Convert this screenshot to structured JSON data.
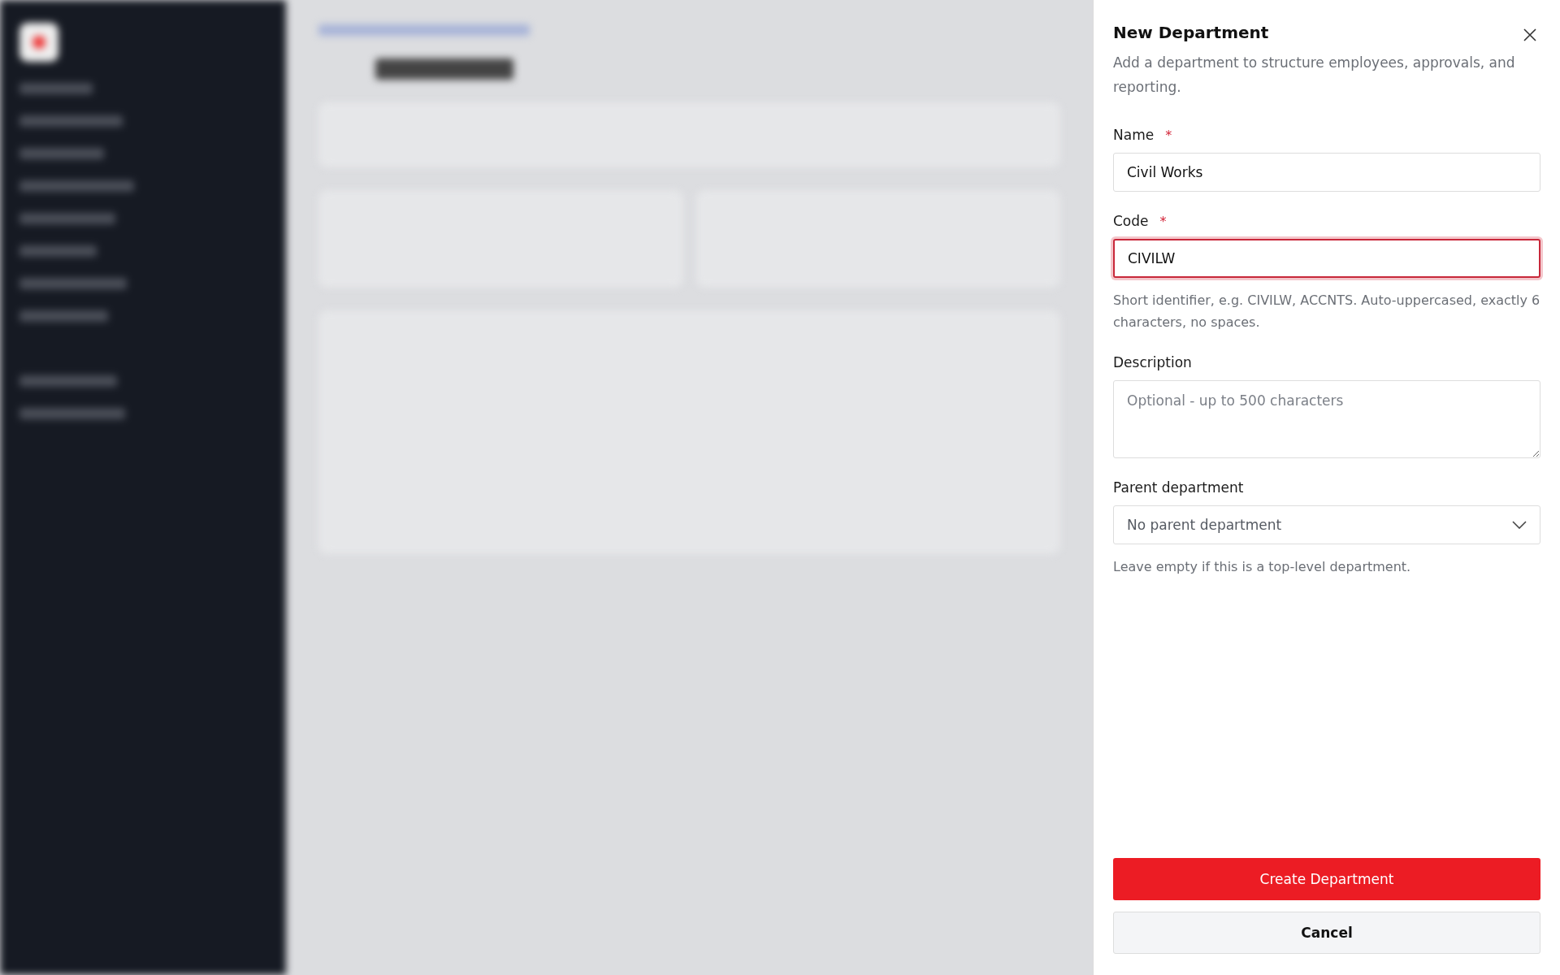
{
  "panel": {
    "title": "New Department",
    "subtitle": "Add a department to structure employees, approvals, and reporting.",
    "fields": [
      {
        "kind": "text",
        "label": "Name",
        "required_mark": "*",
        "value": "Civil Works",
        "invalid": false
      },
      {
        "kind": "text",
        "label": "Code",
        "required_mark": "*",
        "value": "CIVILW",
        "invalid": true,
        "hint": "Short identifier, e.g. CIVILW, ACCNTS. Auto-uppercased, exactly 6 characters, no spaces."
      },
      {
        "kind": "textarea",
        "label": "Description",
        "placeholder": "Optional - up to 500 characters",
        "invalid": false
      },
      {
        "kind": "select",
        "label": "Parent department",
        "value": "No parent department",
        "invalid": false,
        "hint": "Leave empty if this is a top-level department."
      }
    ],
    "buttons": [
      {
        "kind": "primary",
        "label": "Create Department"
      },
      {
        "kind": "secondary",
        "label": "Cancel"
      }
    ]
  }
}
